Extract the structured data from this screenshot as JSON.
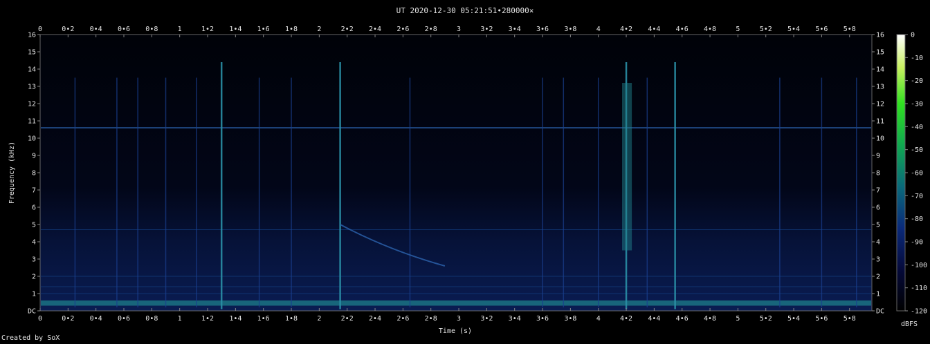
{
  "chart_data": {
    "type": "heatmap",
    "title": "UT 2020-12-30 05:21:51•280000×",
    "xlabel": "Time (s)",
    "ylabel": "Frequency (kHz)",
    "xlim": [
      0,
      5.96
    ],
    "ylim": [
      0,
      16
    ],
    "x_ticks": [
      "0",
      "0•2",
      "0•4",
      "0•6",
      "0•8",
      "1",
      "1•2",
      "1•4",
      "1•6",
      "1•8",
      "2",
      "2•2",
      "2•4",
      "2•6",
      "2•8",
      "3",
      "3•2",
      "3•4",
      "3•6",
      "3•8",
      "4",
      "4•2",
      "4•4",
      "4•6",
      "4•8",
      "5",
      "5•2",
      "5•4",
      "5•6",
      "5•8"
    ],
    "y_ticks": [
      "DC",
      "1",
      "2",
      "3",
      "4",
      "5",
      "6",
      "7",
      "8",
      "9",
      "10",
      "11",
      "12",
      "13",
      "14",
      "15",
      "16"
    ],
    "colorbar": {
      "label": "dBFS",
      "ticks": [
        "0",
        "-10",
        "-20",
        "-30",
        "-40",
        "-50",
        "-60",
        "-70",
        "-80",
        "-90",
        "-100",
        "-110",
        "-120"
      ],
      "range": [
        -120,
        0
      ]
    },
    "features": {
      "hum_line_khz": 10.6,
      "low_band_khz": [
        0.3,
        0.6
      ],
      "strong_impulses_s": [
        1.3,
        2.15,
        4.2,
        4.55
      ],
      "faint_impulses_s": [
        0.25,
        0.55,
        0.7,
        0.9,
        1.12,
        1.57,
        1.8,
        2.65,
        3.6,
        3.75,
        4.0,
        4.35,
        5.3,
        5.6,
        5.85
      ],
      "whistler_start": [
        2.15,
        5.0
      ],
      "whistler_end": [
        2.9,
        2.6
      ]
    }
  },
  "footer": {
    "credit": "Created by SoX"
  }
}
